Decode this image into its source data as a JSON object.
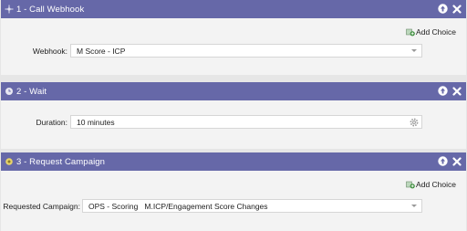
{
  "steps": [
    {
      "title": "1 - Call Webhook",
      "add_choice": "Add Choice",
      "field_label": "Webhook:",
      "field_value": "M Score - ICP"
    },
    {
      "title": "2 - Wait",
      "field_label": "Duration:",
      "field_value": "10 minutes"
    },
    {
      "title": "3 - Request Campaign",
      "add_choice": "Add Choice",
      "field_label": "Requested Campaign:",
      "field_value": "OPS - Scoring   M.ICP/Engagement Score Changes"
    }
  ],
  "colors": {
    "header": "#6668a8",
    "body": "#f3f3f3",
    "add_choice_icon": "#3a8c3a"
  },
  "icons": {
    "step1": "webhook-icon",
    "step2": "clock-icon",
    "step3": "campaign-icon",
    "move_up": "arrow-up-icon",
    "remove": "close-icon",
    "duration_settings": "gear-icon"
  }
}
